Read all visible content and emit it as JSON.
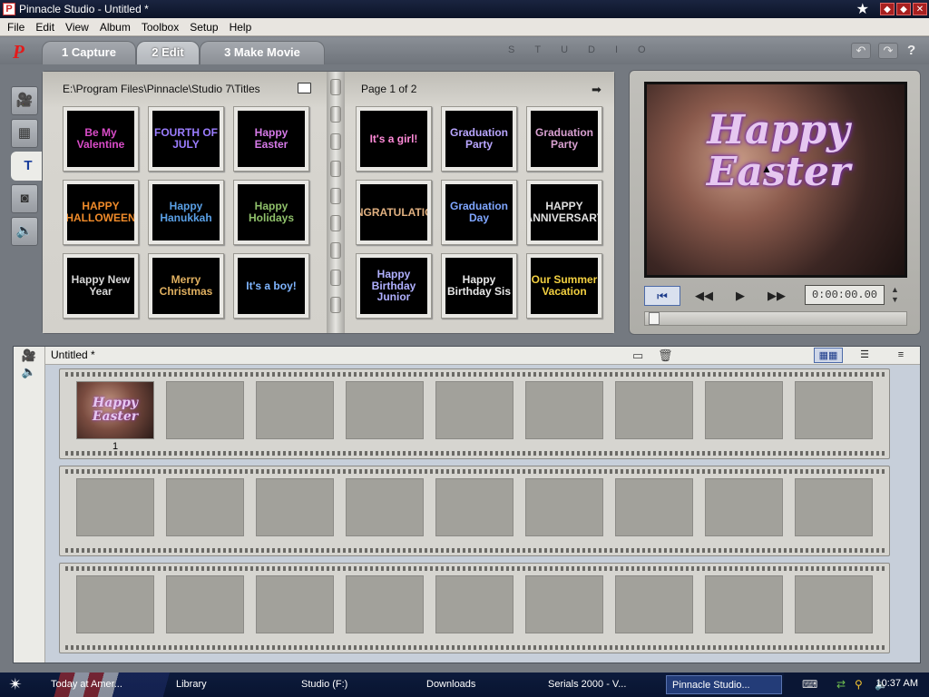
{
  "window": {
    "title": "Pinnacle Studio - Untitled *",
    "controls": [
      "minimize",
      "maximize",
      "close"
    ]
  },
  "menu": [
    "File",
    "Edit",
    "View",
    "Album",
    "Toolbox",
    "Setup",
    "Help"
  ],
  "tabs": [
    {
      "label": "1 Capture"
    },
    {
      "label": "2 Edit"
    },
    {
      "label": "3 Make Movie"
    }
  ],
  "brand_letters": [
    "S",
    "T",
    "U",
    "D",
    "I",
    "O"
  ],
  "topbar": {
    "help_label": "?"
  },
  "album": {
    "path": "E:\\Program Files\\Pinnacle\\Studio 7\\Titles",
    "page_label": "Page 1 of 2",
    "titles_left": [
      {
        "text": "Be My Valentine",
        "color": "#d94cc8"
      },
      {
        "text": "FOURTH OF JULY",
        "color": "#9b7dff"
      },
      {
        "text": "Happy Easter",
        "color": "#d67ae8"
      },
      {
        "text": "HAPPY HALLOWEEN",
        "color": "#f08b2a"
      },
      {
        "text": "Happy Hanukkah",
        "color": "#5aa0e6"
      },
      {
        "text": "Happy Holidays",
        "color": "#8fc06a"
      },
      {
        "text": "Happy New Year",
        "color": "#d8d8d8"
      },
      {
        "text": "Merry Christmas",
        "color": "#e0b060"
      },
      {
        "text": "It's a boy!",
        "color": "#7fb5ff"
      }
    ],
    "titles_right": [
      {
        "text": "It's a girl!",
        "color": "#ff8ad8"
      },
      {
        "text": "Graduation Party",
        "color": "#b9a6ff"
      },
      {
        "text": "Graduation Party",
        "color": "#d8a0d0"
      },
      {
        "text": "CONGRATULATIONS",
        "color": "#e0b080"
      },
      {
        "text": "Graduation Day",
        "color": "#7fa6ff"
      },
      {
        "text": "HAPPY ANNIVERSARY",
        "color": "#e0e0e0"
      },
      {
        "text": "Happy Birthday Junior",
        "color": "#b0b0ff"
      },
      {
        "text": "Happy Birthday Sis",
        "color": "#e8e8e8"
      },
      {
        "text": "Our Summer Vacation",
        "color": "#f2d040"
      }
    ]
  },
  "preview": {
    "title_text": "Happy Easter",
    "timecode": "0:00:00.00",
    "scrub_position": 0
  },
  "storyboard": {
    "title": "Untitled *",
    "clips": [
      {
        "number": "1",
        "title": "Happy Easter"
      }
    ]
  },
  "taskbar": {
    "items": [
      {
        "label": "Today at Amer..."
      },
      {
        "label": "Library"
      },
      {
        "label": "Studio (F:)"
      },
      {
        "label": "Downloads"
      },
      {
        "label": "Serials 2000 - V..."
      },
      {
        "label": "Pinnacle Studio..."
      }
    ],
    "clock": "10:37 AM"
  }
}
